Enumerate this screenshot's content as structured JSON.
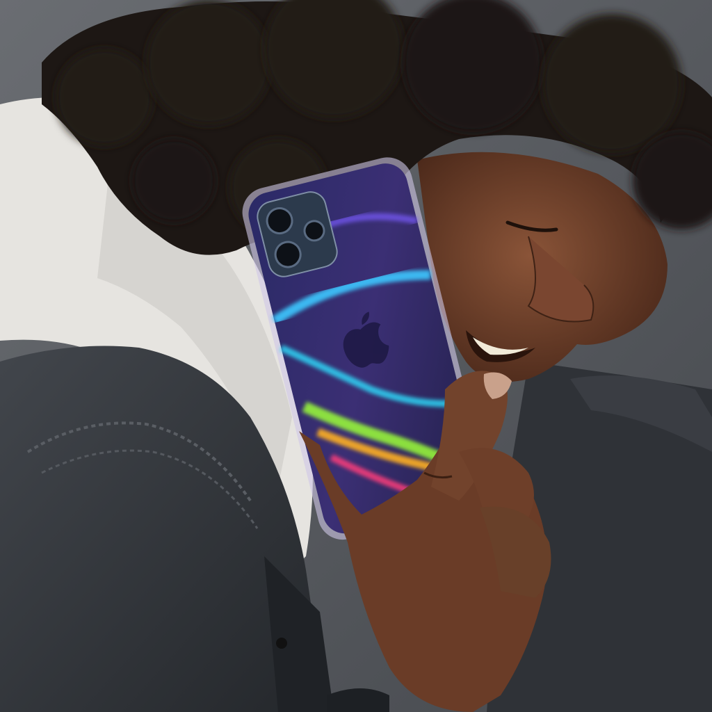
{
  "scene": {
    "subject": "photo",
    "colors": {
      "background": "#5b5e63",
      "hood": "#e9e7e3",
      "denim": "#34373c",
      "skin": "#6b3f2a",
      "hair": "#1c1613",
      "case_edge": "#cfc6e6",
      "iridescent": [
        "#3a2f8f",
        "#2dd1ff",
        "#9bff38",
        "#ffb020",
        "#ff3d7a"
      ]
    },
    "icons": [
      "apple-logo-icon",
      "camera-lens-icon"
    ]
  }
}
